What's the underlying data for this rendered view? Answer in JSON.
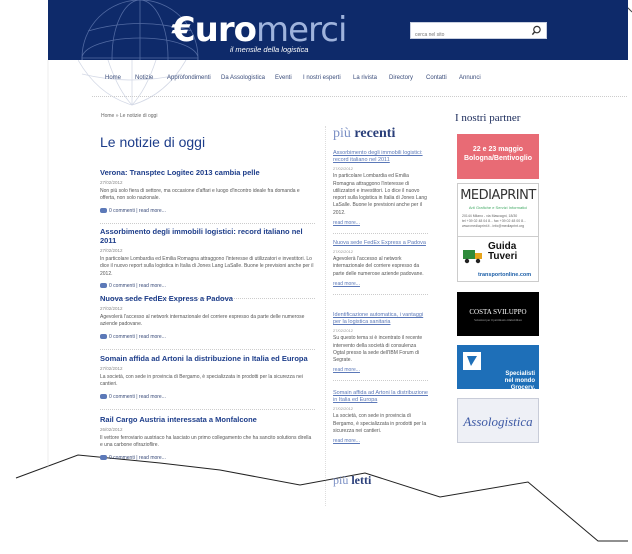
{
  "header": {
    "logo_euro": "€uro",
    "logo_merci": "merci",
    "tagline": "il mensile della logistica",
    "search_placeholder": "cerca nel sito",
    "bg_color": "#0e2a6a"
  },
  "nav": {
    "items": [
      "Home",
      "Notizie",
      "Approfondimenti",
      "Da Assologistica",
      "Eventi",
      "I nostri esperti",
      "La rivista",
      "Directory",
      "Contatti",
      "Annunci"
    ]
  },
  "breadcrumb": "Home » Le notizie di oggi",
  "page_title": "Le notizie di oggi",
  "articles": [
    {
      "title": "Verona: Transptec Logitec 2013 cambia pelle",
      "date": "27/02/2012",
      "body": "Non più solo fiera di settore, ma occasione d'affari e luogo d'incontro ideale fra domanda e offerta, non solo nazionale.",
      "comments": "0 commenti",
      "more": "read more..."
    },
    {
      "title": "Assorbimento degli immobili logistici: record italiano nel 2011",
      "date": "27/02/2012",
      "body": "In particolare Lombardia ed Emilia Romagna attraggono l'interesse di utilizzatori e investitori. Lo dice il nuovo report sulla logistica in Italia di Jones Lang LaSalle. Buone le previsioni anche per il 2012.",
      "comments": "0 commenti",
      "more": "read more..."
    },
    {
      "title": "Nuova sede FedEx Express a Padova",
      "date": "27/02/2012",
      "body": "Agevolerà l'accesso al network internazionale del corriere espresso da parte delle numerose aziende padovane.",
      "comments": "0 commenti",
      "more": "read more..."
    },
    {
      "title": "Somain affida ad Artoni la distribuzione in Italia ed Europa",
      "date": "27/02/2012",
      "body": "La società, con sede in provincia di Bergamo, è specializzata in prodotti per la sicurezza nei cantieri.",
      "comments": "0 commenti",
      "more": "read more..."
    },
    {
      "title": "Rail Cargo Austria interessata a Monfalcone",
      "date": "26/02/2012",
      "body": "Il vettore ferroviario austriaco ha lasciato un primo collegamento che ha sancito solutions dirella e una carbone ofirazioflire.",
      "comments": "0 commenti",
      "more": "read more..."
    }
  ],
  "recent": {
    "heading_light": "più",
    "heading_bold": "recenti",
    "items": [
      {
        "title": "Assorbimento degli immobili logistici: record italiano nel 2011",
        "date": "27/02/2012",
        "body": "In particolare Lombardia ed Emilia Romagna attraggono l'interesse di utilizzatori e investitori. Lo dice il nuovo report sulla logistica in Italia di Jones Lang LaSalle. Buone le previsioni anche per il 2012.",
        "more": "read more..."
      },
      {
        "title": "Nuova sede FedEx Express a Padova",
        "date": "27/02/2012",
        "body": "Agevolerà l'accesso al network internazionale del corriere espresso da parte delle numerose aziende padovane.",
        "more": "read more..."
      },
      {
        "title": "Identificazione automatica, i vantaggi per la logistica sanitaria",
        "date": "27/02/2012",
        "body": "Su questo tema si è incentrato il recente intervento della società di consulenza Ogtal presso la sede dell'IBM Forum di Segrate.",
        "more": "read more..."
      },
      {
        "title": "Somain affida ad Artoni la distribuzione in Italia ed Europa",
        "date": "27/02/2012",
        "body": "La società, con sede in provincia di Bergamo, è specializzata in prodotti per la sicurezza nei cantieri.",
        "more": "read more..."
      }
    ]
  },
  "most_read": {
    "heading_light": "più",
    "heading_bold": "letti"
  },
  "partners": {
    "heading": "I nostri partner",
    "ad1": [
      "22 e 23 maggio",
      "Bologna/Bentivoglio"
    ],
    "media_title": "MEDIAPRINT",
    "media_sub": "Arti Grafiche e Servizi Informatici",
    "media_addr": "20144 Milano - via Mascagni, 18/30\ntel +39 02 48 04 8... fax +39 02 48 00 8...\nwww.mediaprint.it - info@mediaprint.org",
    "guida_top": "Guida",
    "guida_main": "Tuveri",
    "guida_url": "transportonline.com",
    "costa_title": "COSTA SVILUPPO",
    "costa_sub": "Soluzioni per il patrimonio immobiliare",
    "spec_text": [
      "Specialisti",
      "nel mondo Grocery."
    ],
    "asso": "Assologistica"
  }
}
